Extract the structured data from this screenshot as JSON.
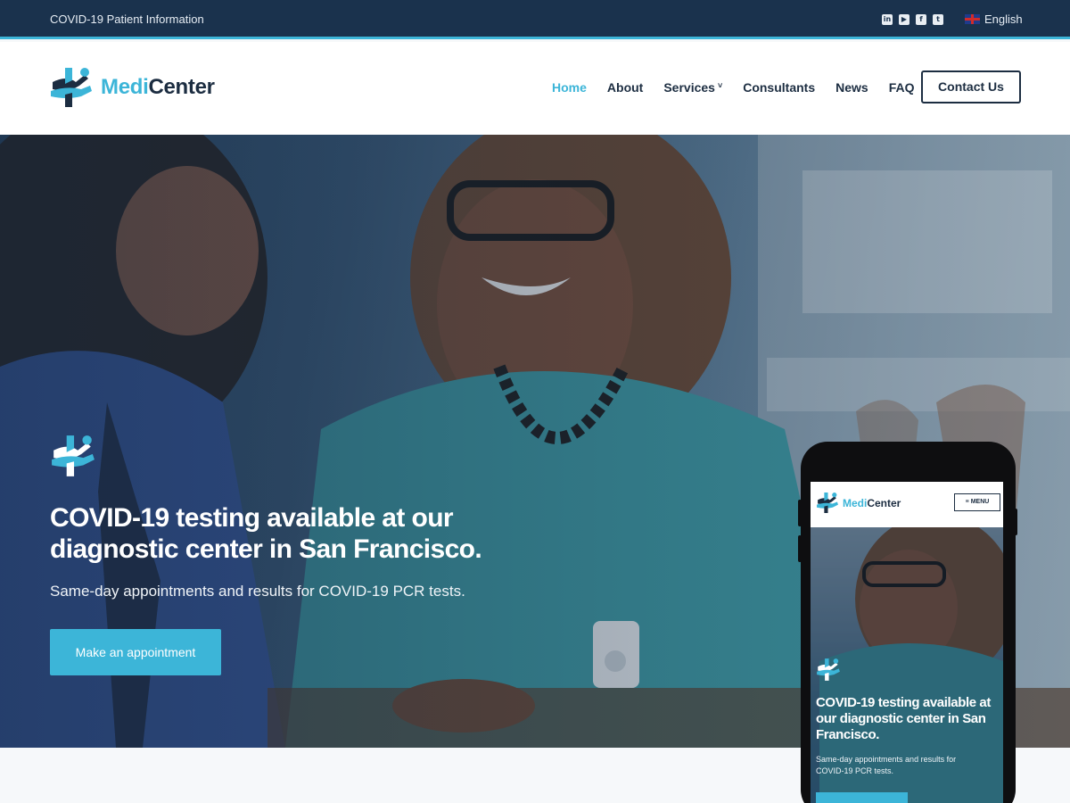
{
  "topbar": {
    "info_text": "COVID-19 Patient Information",
    "socials": [
      {
        "icon": "linkedin-icon",
        "glyph": "in"
      },
      {
        "icon": "youtube-icon",
        "glyph": "▶"
      },
      {
        "icon": "facebook-icon",
        "glyph": "f"
      },
      {
        "icon": "twitter-icon",
        "glyph": "t"
      }
    ],
    "language": "English",
    "language_flag": "uk-flag-icon"
  },
  "header": {
    "logo": {
      "part1": "Medi",
      "part2": "Center"
    },
    "nav": [
      {
        "label": "Home",
        "active": true
      },
      {
        "label": "About"
      },
      {
        "label": "Services",
        "has_dropdown": true,
        "caret": "˅"
      },
      {
        "label": "Consultants"
      },
      {
        "label": "News"
      },
      {
        "label": "FAQ"
      }
    ],
    "contact_label": "Contact Us"
  },
  "hero": {
    "title": "COVID-19 testing available at our diagnostic center in San Francisco.",
    "subtitle": "Same-day appointments and results for COVID-19 PCR tests.",
    "button_label": "Make an appointment"
  },
  "mobile": {
    "logo": {
      "part1": "Medi",
      "part2": "Center"
    },
    "menu_label": "≡ MENU",
    "title": "COVID-19 testing available at our diagnostic center in San Francisco.",
    "subtitle": "Same-day appointments and results for COVID-19 PCR tests."
  },
  "colors": {
    "accent": "#3cb5d8",
    "navy": "#1c2d41",
    "topbar": "#1a324d"
  }
}
